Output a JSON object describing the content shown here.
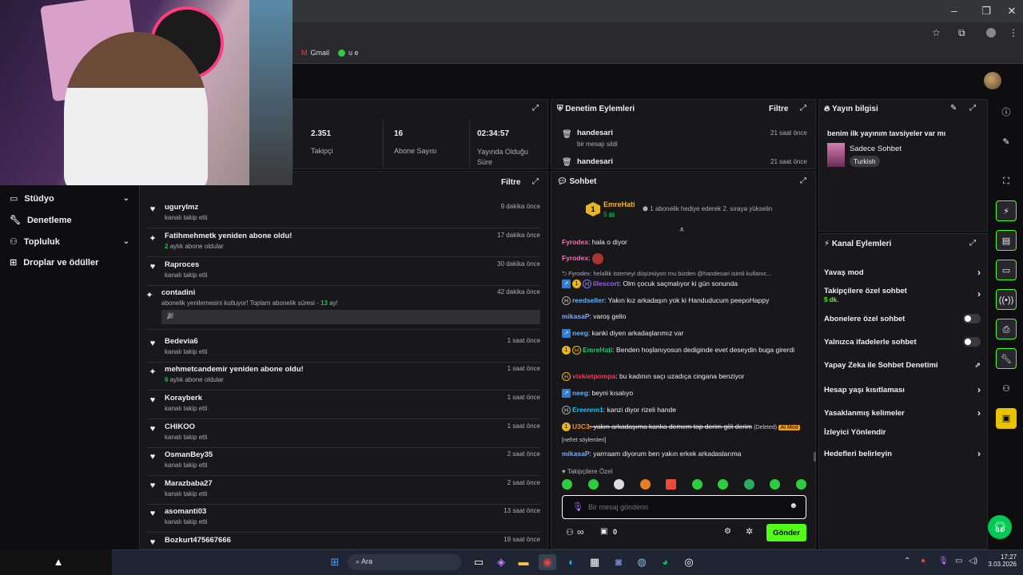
{
  "browser": {
    "bookmarks": [
      "Gmail",
      "u e"
    ]
  },
  "stats": [
    {
      "value": "2.351",
      "label": "Takipçi"
    },
    {
      "value": "16",
      "label": "Abone Sayısı"
    },
    {
      "value": "02:34:57",
      "label": "Yayında Olduğu Süre"
    }
  ],
  "sidebar": {
    "items": [
      {
        "label": "Stüdyo",
        "has_chevron": true
      },
      {
        "label": "Denetleme",
        "has_chevron": false
      },
      {
        "label": "Topluluk",
        "has_chevron": true
      },
      {
        "label": "Droplar ve ödüller",
        "has_chevron": false
      }
    ]
  },
  "activity": {
    "filter_label": "Filtre",
    "items": [
      {
        "icon": "heart",
        "name": "uguryImz",
        "desc": "kanalı takip etti",
        "time": "9 dakika önce"
      },
      {
        "icon": "sparkle",
        "name": "Fatihmehmetk yeniden abone oldu!",
        "desc_num": "2",
        "desc": "aylık abone oldular",
        "time": "17 dakika önce"
      },
      {
        "icon": "heart",
        "name": "Raproces",
        "desc": "kanalı takip etti",
        "time": "30 dakika önce"
      },
      {
        "icon": "sparkle",
        "name": "contadini",
        "desc": "abonelik yenilemesini kutluyor! Toplam abonelik süresi -",
        "desc_num2": "13",
        "desc_tail": "ay!",
        "time": "42 dakika önce"
      },
      {
        "icon": "heart",
        "name": "Bedevia6",
        "desc": "kanalı takip etti",
        "time": "1 saat önce"
      },
      {
        "icon": "sparkle",
        "name": "mehmetcandemir yeniden abone oldu!",
        "desc_num": "6",
        "desc": "aylık abone oldular",
        "time": "1 saat önce"
      },
      {
        "icon": "heart",
        "name": "Korayberk",
        "desc": "kanalı takip etti",
        "time": "1 saat önce"
      },
      {
        "icon": "heart",
        "name": "CHIKOO",
        "desc": "kanalı takip etti",
        "time": "1 saat önce"
      },
      {
        "icon": "heart",
        "name": "OsmanBey35",
        "desc": "kanalı takip etti",
        "time": "2 saat önce"
      },
      {
        "icon": "heart",
        "name": "Marazbaba27",
        "desc": "kanalı takip etti",
        "time": "2 saat önce"
      },
      {
        "icon": "heart",
        "name": "asomanti03",
        "desc": "kanalı takip etti",
        "time": "13 saat önce"
      },
      {
        "icon": "heart",
        "name": "Bozkurt475667666",
        "desc": "",
        "time": "19 saat önce"
      }
    ]
  },
  "moderation": {
    "title": "Denetim Eylemleri",
    "filter_label": "Filtre",
    "entries": [
      {
        "user": "handesari",
        "action": "bir mesajı sildi",
        "time": "21 saat önce"
      },
      {
        "user": "handesari",
        "action": "",
        "time": "21 saat önce"
      }
    ]
  },
  "chat": {
    "title": "Sohbet",
    "pinned_user": "EmreHati",
    "pinned_count": "5",
    "pinned_text": "1 abonelik hediye ederek 2. sıraya yükselin",
    "reply_context": "Fyrodex: helallik istemeyi düşünüyon mu bizden @handesari isimli kullanıc...",
    "messages": [
      {
        "user": "Fyrodex",
        "color": "#ff69b4",
        "text": ": hala o diyor"
      },
      {
        "user": "Fyrodex",
        "color": "#ff69b4",
        "text": ":"
      },
      {
        "user": "lilescort",
        "color": "#9b59ff",
        "text": ": Olm çocuk saçmalıyor ki gün sonunda"
      },
      {
        "user": "reedseller",
        "color": "#5fb3ff",
        "text": ": Yakın kız arkadaşın yok ki Handuducum peepoHappy"
      },
      {
        "user": "mikasaP",
        "color": "#7fa7ff",
        "text": ": varoş gelio"
      },
      {
        "user": "neeg",
        "color": "#5fb3ff",
        "text": ": kanki diyen arkadaşlarımız var"
      },
      {
        "user": "EmreHati",
        "color": "#00d26a",
        "text": ": Benden hoşlanıyosun dediginde evet deseydin buga girerdi"
      },
      {
        "user": "viskietpompa",
        "color": "#ff3355",
        "text": ": bu kadının saçı uzadıça cingana benziyor"
      },
      {
        "user": "neeg",
        "color": "#5fb3ff",
        "text": ": beyni kısalıyo"
      },
      {
        "user": "Ereennn1",
        "color": "#00c6ff",
        "text": ": kanzi diyor rizeli hande"
      },
      {
        "user": "U3C3",
        "color": "#ff8c1a",
        "text": ": yakın arkadaşıma kanka demem top derim göt derim",
        "deleted": "(Deleted)",
        "tag": "AI Mod",
        "reason": "[nefret söylemleri]"
      },
      {
        "user": "mikasaP",
        "color": "#7fa7ff",
        "text": ": yarrraam diyorum ben yakın erkek arkadaslarıma"
      }
    ],
    "followers_only_label": "Takipçilere Özel",
    "input_placeholder": "Bir mesaj gönderin",
    "points": "0",
    "send_label": "Gönder"
  },
  "stream_info": {
    "title": "Yayın bilgisi",
    "stream_title": "benim ilk yayınım tavsiyeler var mı",
    "category": "Sadece Sohbet",
    "tag": "Turkish"
  },
  "channel_actions": {
    "title": "Kanal Eylemleri",
    "rows": [
      {
        "label": "Yavaş mod",
        "type": "chevron"
      },
      {
        "label": "Takipçilere özel sohbet",
        "sub": "5 dk.",
        "type": "chevron"
      },
      {
        "label": "Abonelere özel sohbet",
        "type": "toggle"
      },
      {
        "label": "Yalnızca ifadelerle sohbet",
        "type": "toggle"
      },
      {
        "label": "Yapay Zeka ile Sohbet Denetimi",
        "type": "external"
      },
      {
        "label": "Hesap yaşı kısıtlaması",
        "type": "chevron"
      },
      {
        "label": "Yasaklanmış kelimeler",
        "type": "chevron"
      },
      {
        "label": "İzleyici Yönlendir",
        "type": "none"
      },
      {
        "label": "Hedefleri belirleyin",
        "type": "chevron"
      }
    ]
  },
  "taskbar": {
    "search_label": "Ara",
    "time": "17:27",
    "date": "3.03.2026"
  }
}
